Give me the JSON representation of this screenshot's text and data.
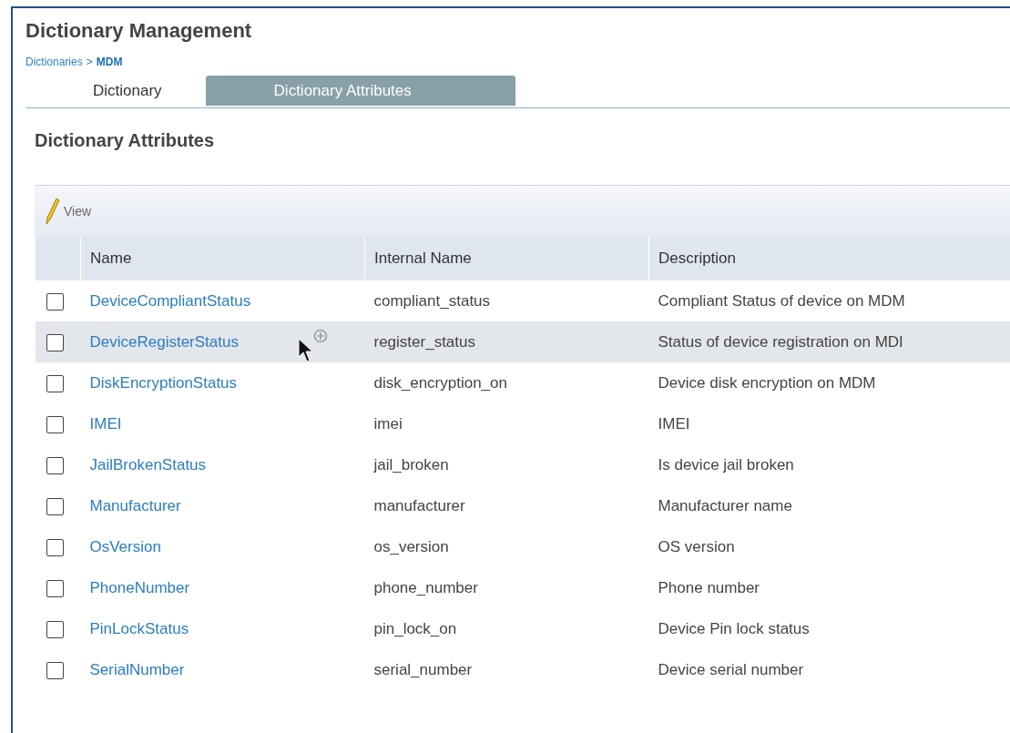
{
  "title": "Dictionary Management",
  "breadcrumb": {
    "parent": "Dictionaries",
    "separator": ">",
    "current": "MDM"
  },
  "tabs": [
    {
      "label": "Dictionary",
      "selected": false
    },
    {
      "label": "Dictionary Attributes",
      "selected": true
    }
  ],
  "section_title": "Dictionary Attributes",
  "toolbar": {
    "view_button": "View"
  },
  "table": {
    "columns": [
      "Name",
      "Internal Name",
      "Description"
    ],
    "rows": [
      {
        "checked": false,
        "hovered": false,
        "name": "DeviceCompliantStatus",
        "internal_name": "compliant_status",
        "description": "Compliant Status of device on MDM"
      },
      {
        "checked": false,
        "hovered": true,
        "name": "DeviceRegisterStatus",
        "internal_name": "register_status",
        "description": "Status of device registration on MDI"
      },
      {
        "checked": false,
        "hovered": false,
        "name": "DiskEncryptionStatus",
        "internal_name": "disk_encryption_on",
        "description": "Device disk encryption on MDM"
      },
      {
        "checked": false,
        "hovered": false,
        "name": "IMEI",
        "internal_name": "imei",
        "description": "IMEI"
      },
      {
        "checked": false,
        "hovered": false,
        "name": "JailBrokenStatus",
        "internal_name": "jail_broken",
        "description": "Is device jail broken"
      },
      {
        "checked": false,
        "hovered": false,
        "name": "Manufacturer",
        "internal_name": "manufacturer",
        "description": "Manufacturer name"
      },
      {
        "checked": false,
        "hovered": false,
        "name": "OsVersion",
        "internal_name": "os_version",
        "description": "OS version"
      },
      {
        "checked": false,
        "hovered": false,
        "name": "PhoneNumber",
        "internal_name": "phone_number",
        "description": "Phone number"
      },
      {
        "checked": false,
        "hovered": false,
        "name": "PinLockStatus",
        "internal_name": "pin_lock_on",
        "description": "Device Pin lock status"
      },
      {
        "checked": false,
        "hovered": false,
        "name": "SerialNumber",
        "internal_name": "serial_number",
        "description": "Device serial number"
      }
    ]
  }
}
